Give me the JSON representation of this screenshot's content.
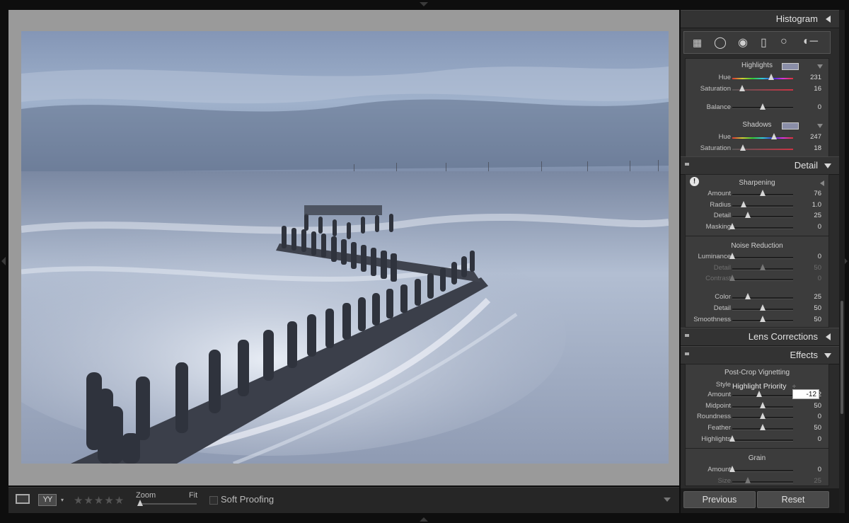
{
  "toolbar": {
    "compare_label": "YY",
    "stars": "★★★★★",
    "zoom_label": "Zoom",
    "fit_label": "Fit",
    "soft_proofing_label": "Soft Proofing"
  },
  "panels": {
    "histogram": {
      "title": "Histogram"
    },
    "detail": {
      "title": "Detail"
    },
    "lens_corrections": {
      "title": "Lens Corrections"
    },
    "effects": {
      "title": "Effects"
    }
  },
  "split_toning": {
    "highlights_title": "Highlights",
    "highlights": [
      {
        "label": "Hue",
        "value": "231",
        "level": 0.64
      },
      {
        "label": "Saturation",
        "value": "16",
        "level": 0.16
      }
    ],
    "balance": {
      "label": "Balance",
      "value": "0",
      "level": 0.5
    },
    "shadows_title": "Shadows",
    "shadows": [
      {
        "label": "Hue",
        "value": "247",
        "level": 0.69
      },
      {
        "label": "Saturation",
        "value": "18",
        "level": 0.18
      }
    ]
  },
  "sharpening": {
    "title": "Sharpening",
    "rows": [
      {
        "label": "Amount",
        "value": "76",
        "level": 0.5
      },
      {
        "label": "Radius",
        "value": "1.0",
        "level": 0.19
      },
      {
        "label": "Detail",
        "value": "25",
        "level": 0.25
      },
      {
        "label": "Masking",
        "value": "0",
        "level": 0.0
      }
    ]
  },
  "noise_reduction": {
    "title": "Noise Reduction",
    "rows": [
      {
        "label": "Luminance",
        "value": "0",
        "level": 0.0
      },
      {
        "label": "Detail",
        "value": "50",
        "level": 0.5
      },
      {
        "label": "Contrast",
        "value": "0",
        "level": 0.0
      },
      {
        "label": "Color",
        "value": "25",
        "level": 0.25
      },
      {
        "label": "Detail",
        "value": "50",
        "level": 0.5
      },
      {
        "label": "Smoothness",
        "value": "50",
        "level": 0.5
      }
    ]
  },
  "vignetting": {
    "title": "Post-Crop Vignetting",
    "style_label": "Style",
    "style_value": "Highlight Priority",
    "style_caret": "÷",
    "amount_input": "-12",
    "rows": [
      {
        "label": "Amount",
        "value": "-12",
        "level": 0.44
      },
      {
        "label": "Midpoint",
        "value": "50",
        "level": 0.5
      },
      {
        "label": "Roundness",
        "value": "0",
        "level": 0.5
      },
      {
        "label": "Feather",
        "value": "50",
        "level": 0.5
      },
      {
        "label": "Highlights",
        "value": "0",
        "level": 0.0
      }
    ]
  },
  "grain": {
    "title": "Grain",
    "rows": [
      {
        "label": "Amount",
        "value": "0",
        "level": 0.0
      },
      {
        "label": "Size",
        "value": "25",
        "level": 0.25
      }
    ]
  },
  "buttons": {
    "previous": "Previous",
    "reset": "Reset"
  },
  "warning_icon": "!",
  "colors": {
    "highlight_swatch": "#8a8ea8",
    "shadow_swatch": "#8a8ea8"
  }
}
